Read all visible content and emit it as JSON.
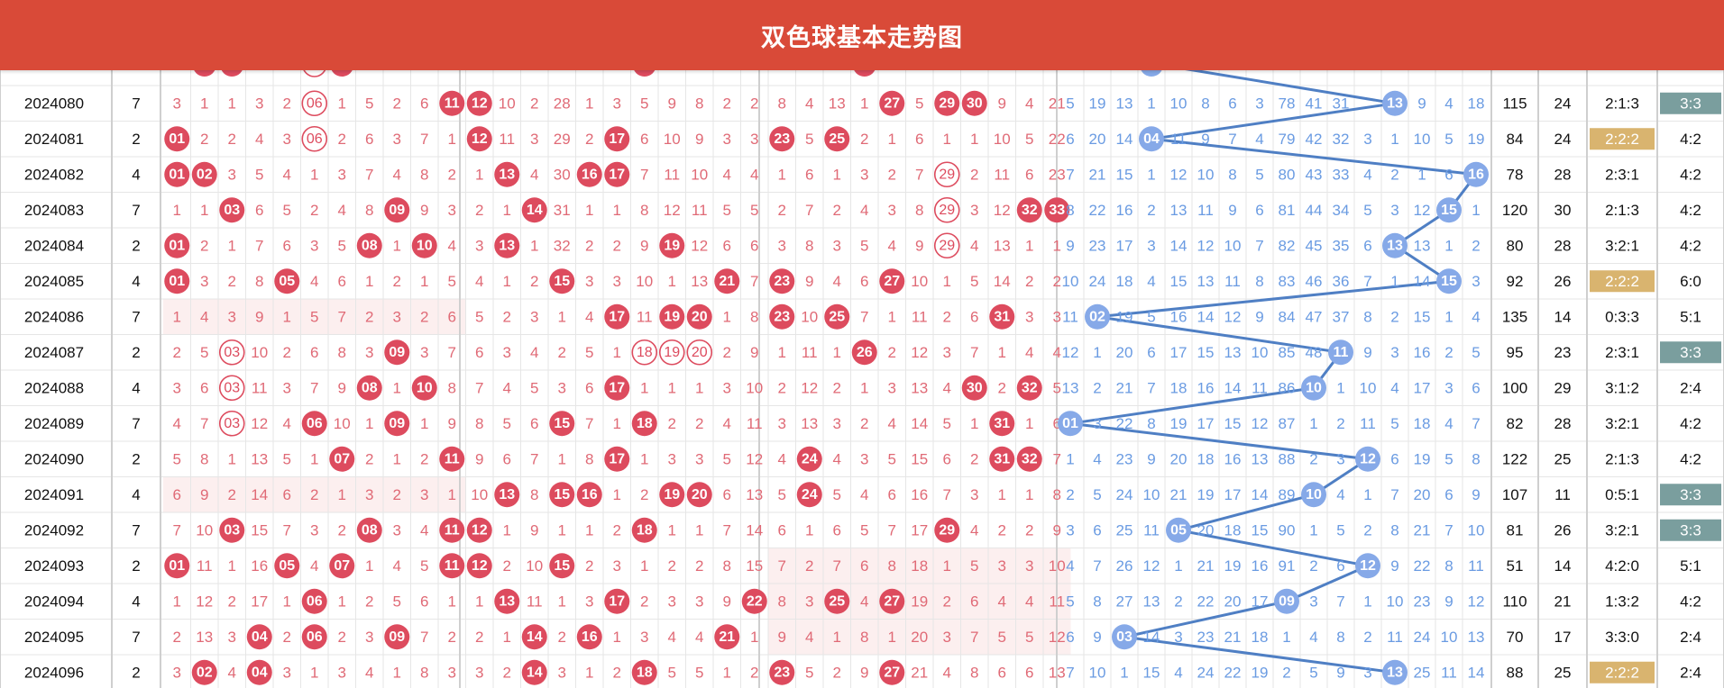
{
  "header": {
    "title": "双色球基本走势图"
  },
  "colors": {
    "header_bg": "#d94a38",
    "red_ball": "#dd4b5e",
    "blue_ball": "#86a9e8",
    "red_miss": "#e06a76",
    "blue_miss": "#6a9be2",
    "connector": "#4f7fc4",
    "badge_gold": "#d9b46f",
    "badge_teal": "#7a9e9e",
    "zone_shade": "#fcefef"
  },
  "icons": [
    "red-ball-icon",
    "blue-ball-icon",
    "repeat-ring-icon",
    "trend-line-icon"
  ],
  "rows": [
    {
      "issue": "2024080",
      "col2": "7",
      "red": [
        "3",
        "1",
        "1",
        "3",
        "2",
        "06r",
        "1",
        "5",
        "2",
        "6",
        "B11",
        "B12",
        "10",
        "2",
        "28",
        "1",
        "3",
        "5",
        "9",
        "8",
        "2",
        "2",
        "8",
        "4",
        "13",
        "1",
        "B27",
        "5",
        "B29",
        "B30",
        "9",
        "4",
        "21"
      ],
      "blue": [
        "5",
        "19",
        "13",
        "1",
        "10",
        "8",
        "6",
        "3",
        "78",
        "41",
        "31",
        "",
        "B13",
        "9",
        "4",
        "18"
      ],
      "sum": "115",
      "span": "24",
      "ratio": "2:1:3",
      "odd": "3:3",
      "odd_style": "teal"
    },
    {
      "issue": "2024081",
      "col2": "2",
      "red": [
        "B01",
        "2",
        "2",
        "4",
        "3",
        "06r",
        "2",
        "6",
        "3",
        "7",
        "1",
        "B12",
        "11",
        "3",
        "29",
        "2",
        "B17",
        "6",
        "10",
        "9",
        "3",
        "3",
        "B23",
        "5",
        "B25",
        "2",
        "1",
        "6",
        "1",
        "1",
        "10",
        "5",
        "22"
      ],
      "blue": [
        "6",
        "20",
        "14",
        "B04",
        "11",
        "9",
        "7",
        "4",
        "79",
        "42",
        "32",
        "3",
        "1",
        "10",
        "5",
        "19"
      ],
      "sum": "84",
      "span": "24",
      "ratio": "2:2:2",
      "ratio_style": "gold",
      "odd": "4:2"
    },
    {
      "issue": "2024082",
      "col2": "4",
      "red": [
        "B01",
        "B02",
        "3",
        "5",
        "4",
        "1",
        "3",
        "7",
        "4",
        "8",
        "2",
        "1",
        "B13",
        "4",
        "30",
        "B16",
        "B17",
        "7",
        "11",
        "10",
        "4",
        "4",
        "1",
        "6",
        "1",
        "3",
        "2",
        "7",
        "29r",
        "2",
        "11",
        "6",
        "23"
      ],
      "blue": [
        "7",
        "21",
        "15",
        "1",
        "12",
        "10",
        "8",
        "5",
        "80",
        "43",
        "33",
        "4",
        "2",
        "1",
        "6",
        "B16"
      ],
      "sum": "78",
      "span": "28",
      "ratio": "2:3:1",
      "odd": "4:2"
    },
    {
      "issue": "2024083",
      "col2": "7",
      "red": [
        "1",
        "1",
        "B03",
        "6",
        "5",
        "2",
        "4",
        "8",
        "B09",
        "9",
        "3",
        "2",
        "1",
        "B14",
        "31",
        "1",
        "1",
        "8",
        "12",
        "11",
        "5",
        "5",
        "2",
        "7",
        "2",
        "4",
        "3",
        "8",
        "29r",
        "3",
        "12",
        "B32",
        "B33"
      ],
      "blue": [
        "8",
        "22",
        "16",
        "2",
        "13",
        "11",
        "9",
        "6",
        "81",
        "44",
        "34",
        "5",
        "3",
        "12",
        "B15",
        "1"
      ],
      "sum": "120",
      "span": "30",
      "ratio": "2:1:3",
      "odd": "4:2"
    },
    {
      "issue": "2024084",
      "col2": "2",
      "red": [
        "B01",
        "2",
        "1",
        "7",
        "6",
        "3",
        "5",
        "B08",
        "1",
        "B10",
        "4",
        "3",
        "B13",
        "1",
        "32",
        "2",
        "2",
        "9",
        "B19",
        "12",
        "6",
        "6",
        "3",
        "8",
        "3",
        "5",
        "4",
        "9",
        "29r",
        "4",
        "13",
        "1",
        "1"
      ],
      "blue": [
        "9",
        "23",
        "17",
        "3",
        "14",
        "12",
        "10",
        "7",
        "82",
        "45",
        "35",
        "6",
        "B13",
        "13",
        "1",
        "2"
      ],
      "sum": "80",
      "span": "28",
      "ratio": "3:2:1",
      "odd": "4:2"
    },
    {
      "issue": "2024085",
      "col2": "4",
      "red": [
        "B01",
        "3",
        "2",
        "8",
        "B05",
        "4",
        "6",
        "1",
        "2",
        "1",
        "5",
        "4",
        "1",
        "2",
        "B15",
        "3",
        "3",
        "10",
        "1",
        "13",
        "B21",
        "7",
        "B23",
        "9",
        "4",
        "6",
        "B27",
        "10",
        "1",
        "5",
        "14",
        "2",
        "2"
      ],
      "blue": [
        "10",
        "24",
        "18",
        "4",
        "15",
        "13",
        "11",
        "8",
        "83",
        "46",
        "36",
        "7",
        "1",
        "14",
        "B15",
        "3"
      ],
      "sum": "92",
      "span": "26",
      "ratio": "2:2:2",
      "ratio_style": "gold",
      "odd": "6:0"
    },
    {
      "issue": "2024086",
      "col2": "7",
      "red": [
        "1",
        "4",
        "3",
        "9",
        "1",
        "5",
        "7",
        "2",
        "3",
        "2",
        "6",
        "5",
        "2",
        "3",
        "1",
        "4",
        "B17",
        "11",
        "B19",
        "B20",
        "1",
        "8",
        "B23",
        "10",
        "B25",
        "7",
        "1",
        "11",
        "2",
        "6",
        "B31",
        "3",
        "3"
      ],
      "blue": [
        "11",
        "B02",
        "19",
        "5",
        "16",
        "14",
        "12",
        "9",
        "84",
        "47",
        "37",
        "8",
        "2",
        "15",
        "1",
        "4"
      ],
      "sum": "135",
      "span": "14",
      "ratio": "0:3:3",
      "odd": "5:1",
      "shade1": true
    },
    {
      "issue": "2024087",
      "col2": "2",
      "red": [
        "2",
        "5",
        "03r",
        "10",
        "2",
        "6",
        "8",
        "3",
        "B09",
        "3",
        "7",
        "6",
        "3",
        "4",
        "2",
        "5",
        "1",
        "18r",
        "19r",
        "20r",
        "2",
        "9",
        "1",
        "11",
        "1",
        "B26",
        "2",
        "12",
        "3",
        "7",
        "1",
        "4",
        "4"
      ],
      "blue": [
        "12",
        "1",
        "20",
        "6",
        "17",
        "15",
        "13",
        "10",
        "85",
        "48",
        "B11",
        "9",
        "3",
        "16",
        "2",
        "5"
      ],
      "sum": "95",
      "span": "23",
      "ratio": "2:3:1",
      "odd": "3:3",
      "odd_style": "teal"
    },
    {
      "issue": "2024088",
      "col2": "4",
      "red": [
        "3",
        "6",
        "03r",
        "11",
        "3",
        "7",
        "9",
        "B08",
        "1",
        "B10",
        "8",
        "7",
        "4",
        "5",
        "3",
        "6",
        "B17",
        "1",
        "1",
        "1",
        "3",
        "10",
        "2",
        "12",
        "2",
        "1",
        "3",
        "13",
        "4",
        "B30",
        "2",
        "B32",
        "5"
      ],
      "blue": [
        "13",
        "2",
        "21",
        "7",
        "18",
        "16",
        "14",
        "11",
        "86",
        "B10",
        "1",
        "10",
        "4",
        "17",
        "3",
        "6"
      ],
      "sum": "100",
      "span": "29",
      "ratio": "3:1:2",
      "odd": "2:4"
    },
    {
      "issue": "2024089",
      "col2": "7",
      "red": [
        "4",
        "7",
        "03r",
        "12",
        "4",
        "B06",
        "10",
        "1",
        "B09",
        "1",
        "9",
        "8",
        "5",
        "6",
        "B15",
        "7",
        "1",
        "B18",
        "2",
        "2",
        "4",
        "11",
        "3",
        "13",
        "3",
        "2",
        "4",
        "14",
        "5",
        "1",
        "B31",
        "1",
        "6"
      ],
      "blue": [
        "B01",
        "3",
        "22",
        "8",
        "19",
        "17",
        "15",
        "12",
        "87",
        "1",
        "2",
        "11",
        "5",
        "18",
        "4",
        "7"
      ],
      "sum": "82",
      "span": "28",
      "ratio": "3:2:1",
      "odd": "4:2"
    },
    {
      "issue": "2024090",
      "col2": "2",
      "red": [
        "5",
        "8",
        "1",
        "13",
        "5",
        "1",
        "B07",
        "2",
        "1",
        "2",
        "B11",
        "9",
        "6",
        "7",
        "1",
        "8",
        "B17",
        "1",
        "3",
        "3",
        "5",
        "12",
        "4",
        "B24",
        "4",
        "3",
        "5",
        "15",
        "6",
        "2",
        "B31",
        "B32",
        "7"
      ],
      "blue": [
        "1",
        "4",
        "23",
        "9",
        "20",
        "18",
        "16",
        "13",
        "88",
        "2",
        "3",
        "B12",
        "6",
        "19",
        "5",
        "8"
      ],
      "sum": "122",
      "span": "25",
      "ratio": "2:1:3",
      "odd": "4:2"
    },
    {
      "issue": "2024091",
      "col2": "4",
      "red": [
        "6",
        "9",
        "2",
        "14",
        "6",
        "2",
        "1",
        "3",
        "2",
        "3",
        "1",
        "10",
        "B13",
        "8",
        "B15",
        "B16",
        "1",
        "2",
        "B19",
        "B20",
        "6",
        "13",
        "5",
        "B24",
        "5",
        "4",
        "6",
        "16",
        "7",
        "3",
        "1",
        "1",
        "8"
      ],
      "blue": [
        "2",
        "5",
        "24",
        "10",
        "21",
        "19",
        "17",
        "14",
        "89",
        "B10",
        "4",
        "1",
        "7",
        "20",
        "6",
        "9"
      ],
      "sum": "107",
      "span": "11",
      "ratio": "0:5:1",
      "odd": "3:3",
      "odd_style": "teal",
      "shade1": true
    },
    {
      "issue": "2024092",
      "col2": "7",
      "red": [
        "7",
        "10",
        "B03",
        "15",
        "7",
        "3",
        "2",
        "B08",
        "3",
        "4",
        "B11",
        "B12",
        "1",
        "9",
        "1",
        "1",
        "2",
        "B18",
        "1",
        "1",
        "7",
        "14",
        "6",
        "1",
        "6",
        "5",
        "7",
        "17",
        "B29",
        "4",
        "2",
        "2",
        "9"
      ],
      "blue": [
        "3",
        "6",
        "25",
        "11",
        "B05",
        "20",
        "18",
        "15",
        "90",
        "1",
        "5",
        "2",
        "8",
        "21",
        "7",
        "10"
      ],
      "sum": "81",
      "span": "26",
      "ratio": "3:2:1",
      "odd": "3:3",
      "odd_style": "teal"
    },
    {
      "issue": "2024093",
      "col2": "2",
      "red": [
        "B01",
        "11",
        "1",
        "16",
        "B05",
        "4",
        "B07",
        "1",
        "4",
        "5",
        "B11",
        "B12",
        "2",
        "10",
        "B15",
        "2",
        "3",
        "1",
        "2",
        "2",
        "8",
        "15",
        "7",
        "2",
        "7",
        "6",
        "8",
        "18",
        "1",
        "5",
        "3",
        "3",
        "10"
      ],
      "blue": [
        "4",
        "7",
        "26",
        "12",
        "1",
        "21",
        "19",
        "16",
        "91",
        "2",
        "6",
        "B12",
        "9",
        "22",
        "8",
        "11"
      ],
      "sum": "51",
      "span": "14",
      "ratio": "4:2:0",
      "odd": "5:1",
      "shade3": true
    },
    {
      "issue": "2024094",
      "col2": "4",
      "red": [
        "1",
        "12",
        "2",
        "17",
        "1",
        "B06",
        "1",
        "2",
        "5",
        "6",
        "1",
        "1",
        "B13",
        "11",
        "1",
        "3",
        "B17",
        "2",
        "3",
        "3",
        "9",
        "B22",
        "8",
        "3",
        "B25",
        "4",
        "B27",
        "19",
        "2",
        "6",
        "4",
        "4",
        "11"
      ],
      "blue": [
        "5",
        "8",
        "27",
        "13",
        "2",
        "22",
        "20",
        "17",
        "B09",
        "3",
        "7",
        "1",
        "10",
        "23",
        "9",
        "12"
      ],
      "sum": "110",
      "span": "21",
      "ratio": "1:3:2",
      "odd": "4:2",
      "shade3": true
    },
    {
      "issue": "2024095",
      "col2": "7",
      "red": [
        "2",
        "13",
        "3",
        "B04",
        "2",
        "B06",
        "2",
        "3",
        "B09",
        "7",
        "2",
        "2",
        "1",
        "B14",
        "2",
        "B16",
        "1",
        "3",
        "4",
        "4",
        "B21",
        "1",
        "9",
        "4",
        "1",
        "8",
        "1",
        "20",
        "3",
        "7",
        "5",
        "5",
        "12"
      ],
      "blue": [
        "6",
        "9",
        "B03",
        "14",
        "3",
        "23",
        "21",
        "18",
        "1",
        "4",
        "8",
        "2",
        "11",
        "24",
        "10",
        "13"
      ],
      "sum": "70",
      "span": "17",
      "ratio": "3:3:0",
      "odd": "2:4",
      "shade3": true
    },
    {
      "issue": "2024096",
      "col2": "2",
      "red": [
        "3",
        "B02",
        "4",
        "B04",
        "3",
        "1",
        "3",
        "4",
        "1",
        "8",
        "3",
        "3",
        "2",
        "B14",
        "3",
        "1",
        "2",
        "B18",
        "5",
        "5",
        "1",
        "2",
        "B23",
        "5",
        "2",
        "9",
        "B27",
        "21",
        "4",
        "8",
        "6",
        "6",
        "13"
      ],
      "blue": [
        "7",
        "10",
        "1",
        "15",
        "4",
        "24",
        "22",
        "19",
        "2",
        "5",
        "9",
        "3",
        "B13",
        "25",
        "11",
        "14"
      ],
      "sum": "88",
      "span": "25",
      "ratio": "2:2:2",
      "ratio_style": "gold",
      "odd": "2:4"
    }
  ]
}
